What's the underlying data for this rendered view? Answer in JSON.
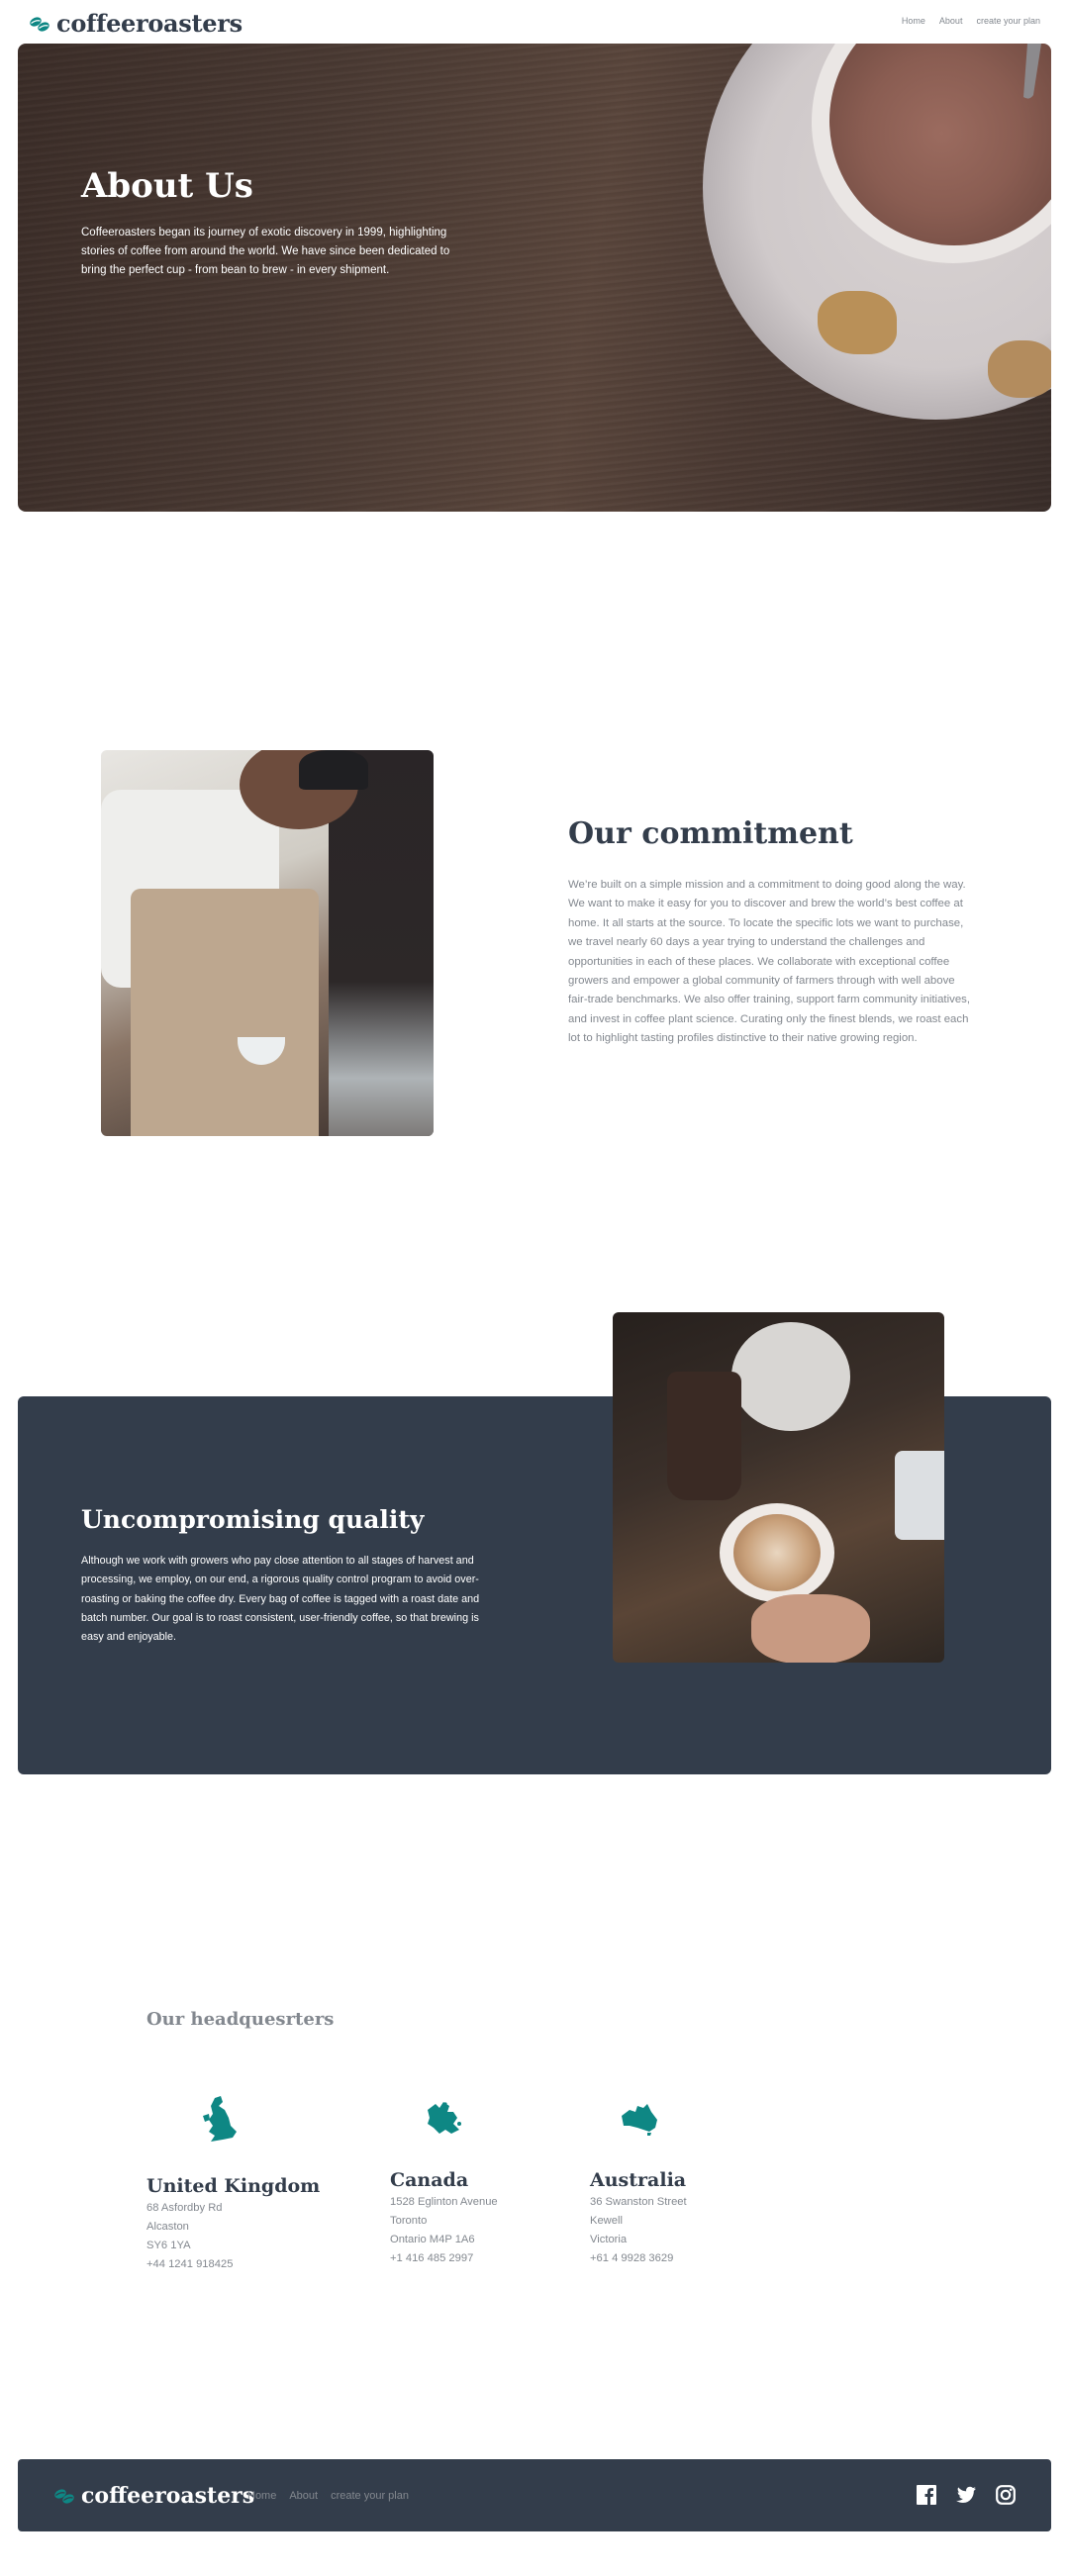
{
  "brand": {
    "name": "coffeeroasters",
    "accent": "#0e8784",
    "dark": "#333d4b",
    "grey": "#83888f"
  },
  "header": {
    "nav": [
      {
        "label": "Home"
      },
      {
        "label": "About"
      },
      {
        "label": "create your plan"
      }
    ]
  },
  "hero": {
    "title": "About Us",
    "text": "Coffeeroasters began its journey of exotic discovery in 1999, highlighting stories of coffee from around the world. We have since been dedicated to bring the perfect cup - from bean to brew - in every shipment."
  },
  "commitment": {
    "title": "Our commitment",
    "text": "We’re built on a simple mission and a commitment to doing good along the way. We want to make it easy for you to discover and brew the world’s best coffee at home. It all starts at the source. To locate the specific lots we want to purchase, we travel nearly 60 days a year trying to understand the challenges and opportunities in each of these places. We collaborate with exceptional coffee growers and empower a global community of farmers through with well above fair-trade benchmarks. We also offer training, support farm community initiatives, and invest in coffee plant science. Curating only the finest blends, we roast each lot to highlight tasting profiles distinctive to their native growing region."
  },
  "quality": {
    "title": "Uncompromising quality",
    "text": "Although we work with growers who pay close attention to all stages of harvest and processing, we employ, on our end, a rigorous quality control program to avoid over-roasting or baking the coffee dry. Every bag of coffee is tagged with a roast date and batch number. Our goal is to roast consistent, user-friendly coffee, so that brewing is easy and enjoyable."
  },
  "headquarters": {
    "title": "Our headquesrters",
    "offices": [
      {
        "icon": "united-kingdom-map-icon",
        "country": "United Kingdom",
        "lines": [
          "68 Asfordby Rd",
          "Alcaston",
          "SY6 1YA",
          "+44 1241 918425"
        ]
      },
      {
        "icon": "canada-map-icon",
        "country": "Canada",
        "lines": [
          "1528 Eglinton Avenue",
          "Toronto",
          "Ontario M4P 1A6",
          "+1 416 485 2997"
        ]
      },
      {
        "icon": "australia-map-icon",
        "country": "Australia",
        "lines": [
          "36 Swanston Street",
          "Kewell",
          "Victoria",
          "+61 4 9928 3629"
        ]
      }
    ]
  },
  "footer": {
    "nav": [
      {
        "label": "Home"
      },
      {
        "label": "About"
      },
      {
        "label": "create your plan"
      }
    ],
    "socials": [
      "facebook-icon",
      "twitter-icon",
      "instagram-icon"
    ]
  }
}
